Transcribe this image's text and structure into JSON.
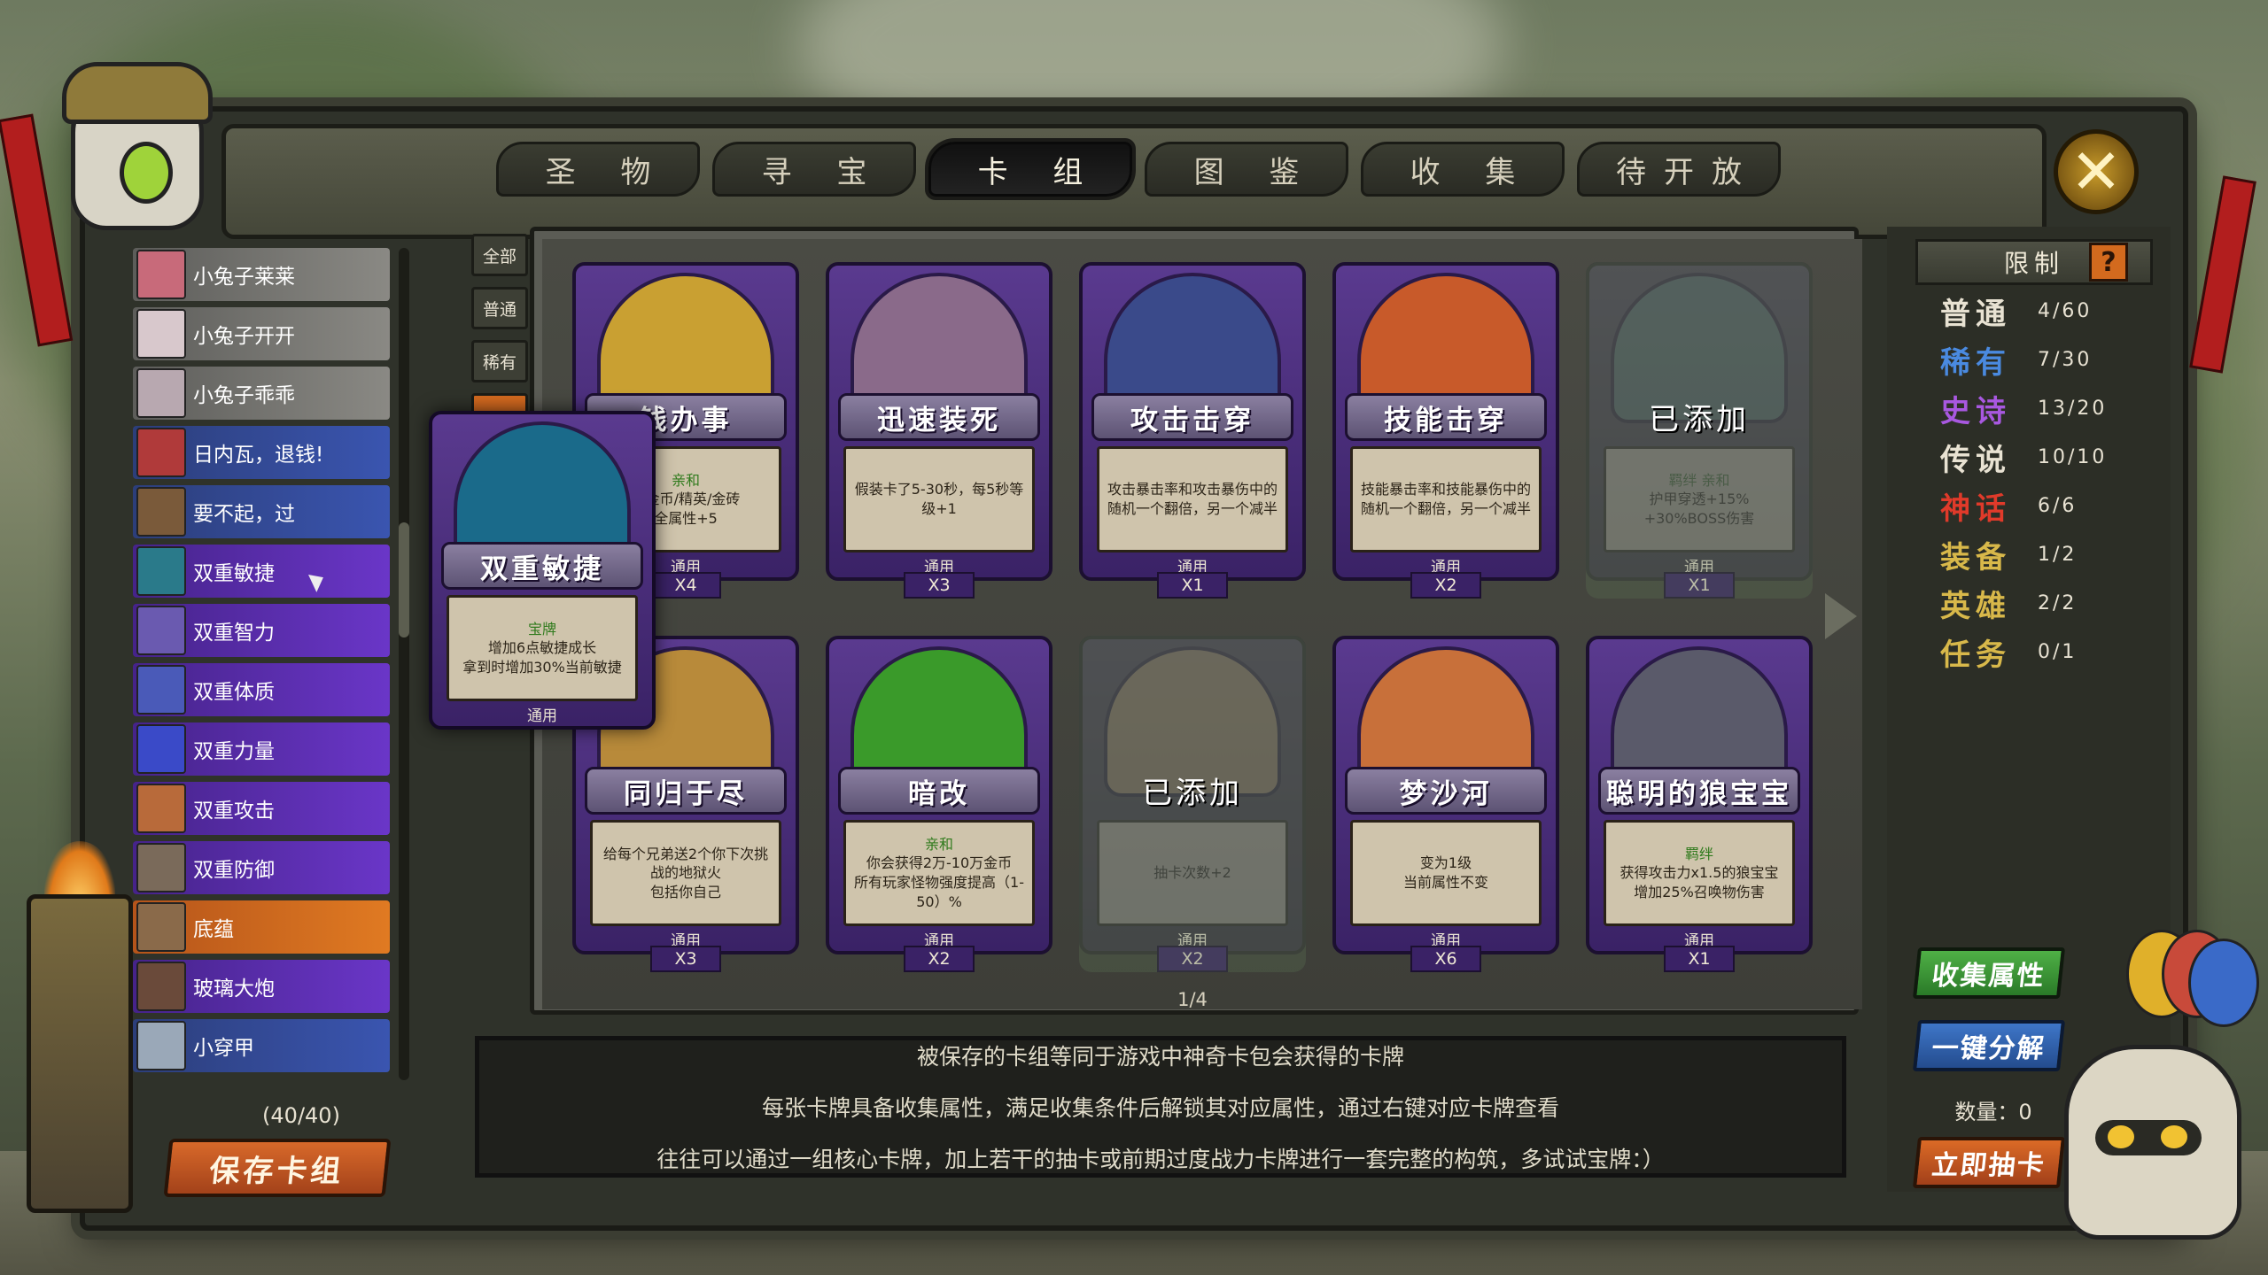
{
  "tabs": [
    {
      "label": "圣 物",
      "active": false
    },
    {
      "label": "寻 宝",
      "active": false
    },
    {
      "label": "卡 组",
      "active": true
    },
    {
      "label": "图 鉴",
      "active": false
    },
    {
      "label": "收 集",
      "active": false
    },
    {
      "label": "待开放",
      "active": false
    }
  ],
  "deck_list": [
    {
      "label": "小兔子莱莱",
      "color": "gray",
      "thumb": "#c86a7a"
    },
    {
      "label": "小兔子开开",
      "color": "gray",
      "thumb": "#d8c8cc"
    },
    {
      "label": "小兔子乖乖",
      "color": "gray",
      "thumb": "#b8a8b0"
    },
    {
      "label": "日内瓦，退钱!",
      "color": "blue",
      "thumb": "#b03a3a"
    },
    {
      "label": "要不起，过",
      "color": "blue",
      "thumb": "#7a5a3a"
    },
    {
      "label": "双重敏捷",
      "color": "purple",
      "thumb": "#2a7a8a"
    },
    {
      "label": "双重智力",
      "color": "purple",
      "thumb": "#6a5ab0"
    },
    {
      "label": "双重体质",
      "color": "purple",
      "thumb": "#4a5ab8"
    },
    {
      "label": "双重力量",
      "color": "purple",
      "thumb": "#3a4ac8"
    },
    {
      "label": "双重攻击",
      "color": "purple",
      "thumb": "#b86a3a"
    },
    {
      "label": "双重防御",
      "color": "purple",
      "thumb": "#7a6a5a"
    },
    {
      "label": "底蕴",
      "color": "orange",
      "thumb": "#8a6a4a"
    },
    {
      "label": "玻璃大炮",
      "color": "purple",
      "thumb": "#6a4a3a"
    },
    {
      "label": "小穿甲",
      "color": "blue",
      "thumb": "#9aa8b8"
    }
  ],
  "deck_count": "(40/40)",
  "save_button": "保存卡组",
  "filters": [
    "全部",
    "普通",
    "稀有"
  ],
  "cards": [
    {
      "name": "钱办事",
      "tag": "亲和",
      "desc": "个金币/精英/金砖\n全属性+5",
      "gen": "通用",
      "mult": "X4",
      "added": false,
      "art": "#c9a032"
    },
    {
      "name": "迅速装死",
      "tag": "",
      "desc": "假装卡了5-30秒，每5秒等级+1",
      "gen": "通用",
      "mult": "X3",
      "added": false,
      "art": "#8a6a8a"
    },
    {
      "name": "攻击击穿",
      "tag": "",
      "desc": "攻击暴击率和攻击暴伤中的随机一个翻倍，另一个减半",
      "gen": "通用",
      "mult": "X1",
      "added": false,
      "art": "#3a4a8a"
    },
    {
      "name": "技能击穿",
      "tag": "",
      "desc": "技能暴击率和技能暴伤中的随机一个翻倍，另一个减半",
      "gen": "通用",
      "mult": "X2",
      "added": false,
      "art": "#c85a2a"
    },
    {
      "name": "已添加",
      "tag": "羁绊 亲和",
      "desc": "护甲穿透+15%\n+30%BOSS伤害",
      "gen": "通用",
      "mult": "X1",
      "added": true,
      "art": "#4a7a7a"
    },
    {
      "name": "同归于尽",
      "tag": "",
      "desc": "给每个兄弟送2个你下次挑战的地狱火\n包括你自己",
      "gen": "通用",
      "mult": "X3",
      "added": false,
      "art": "#b88a3a"
    },
    {
      "name": "暗改",
      "tag": "亲和",
      "desc": "你会获得2万-10万金币\n所有玩家怪物强度提高（1-50）%",
      "gen": "通用",
      "mult": "X2",
      "added": false,
      "art": "#3a9a2a"
    },
    {
      "name": "已添加",
      "tag": "",
      "desc": "抽卡次数+2",
      "gen": "通用",
      "mult": "X2",
      "added": true,
      "art": "#b8905a"
    },
    {
      "name": "梦沙河",
      "tag": "",
      "desc": "变为1级\n当前属性不变",
      "gen": "通用",
      "mult": "X6",
      "added": false,
      "art": "#c8703a"
    },
    {
      "name": "聪明的狼宝宝",
      "tag": "羁绊",
      "desc": "获得攻击力x1.5的狼宝宝\n增加25%召唤物伤害",
      "gen": "通用",
      "mult": "X1",
      "added": false,
      "art": "#5a5a6a"
    }
  ],
  "big_card": {
    "name": "双重敏捷",
    "tag": "宝牌",
    "desc": "增加6点敏捷成长\n拿到时增加30%当前敏捷",
    "gen": "通用",
    "art": "#1a6a8a"
  },
  "page_indicator": "1/4",
  "info_lines": [
    "被保存的卡组等同于游戏中神奇卡包会获得的卡牌",
    "每张卡牌具备收集属性，满足收集条件后解锁其对应属性，通过右键对应卡牌查看",
    "往往可以通过一组核心卡牌，加上若干的抽卡或前期过度战力卡牌进行一套完整的构筑，多试试宝牌：）"
  ],
  "limit": {
    "title": "限制",
    "help": "?",
    "rows": [
      {
        "label": "普通",
        "value": "4/60",
        "color": "#e8e2d2"
      },
      {
        "label": "稀有",
        "value": "7/30",
        "color": "#4a8ae0"
      },
      {
        "label": "史诗",
        "value": "13/20",
        "color": "#a858e0"
      },
      {
        "label": "传说",
        "value": "10/10",
        "color": "#e8e2d2"
      },
      {
        "label": "神话",
        "value": "6/6",
        "color": "#e03a2a"
      },
      {
        "label": "装备",
        "value": "1/2",
        "color": "#d8b84a"
      },
      {
        "label": "英雄",
        "value": "2/2",
        "color": "#d8b84a"
      },
      {
        "label": "任务",
        "value": "0/1",
        "color": "#d8b84a"
      }
    ]
  },
  "right_buttons": {
    "collect": "收集属性",
    "decompose": "一键分解",
    "quantity": "数量：0",
    "draw": "立即抽卡"
  },
  "close_icon": "close-icon"
}
